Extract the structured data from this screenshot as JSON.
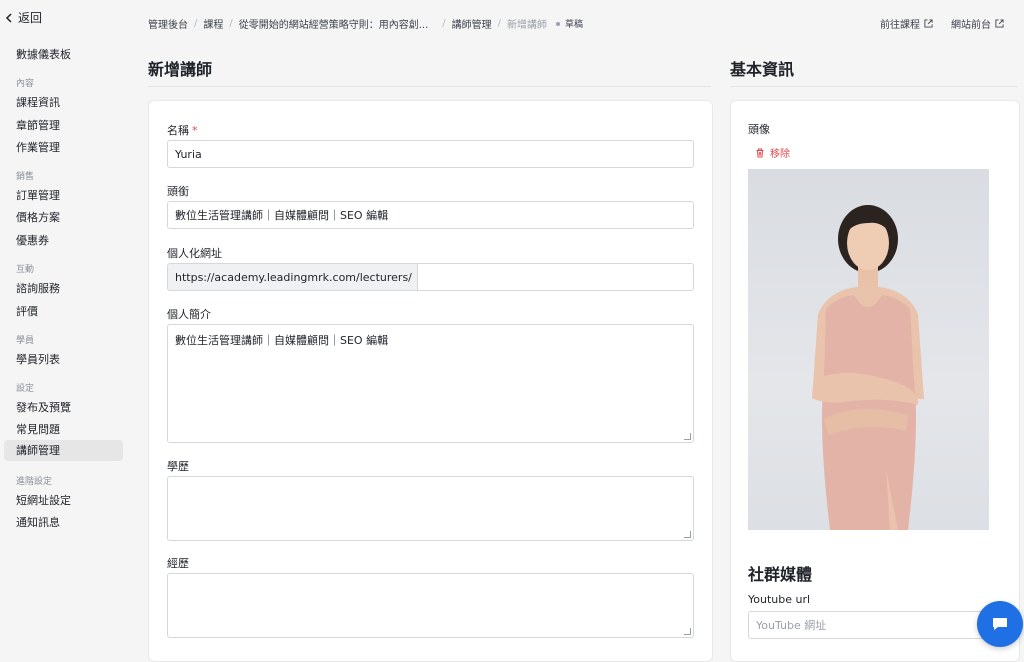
{
  "sidebar": {
    "back_label": "返回",
    "dashboard": "數據儀表板",
    "groups": {
      "content": "內容",
      "sales": "銷售",
      "interaction": "互動",
      "students": "學員",
      "settings": "設定",
      "advanced": "進階設定"
    },
    "items": {
      "course_info": "課程資訊",
      "chapters": "章節管理",
      "homework": "作業管理",
      "orders": "訂單管理",
      "pricing": "價格方案",
      "coupons": "優惠券",
      "consulting": "諮詢服務",
      "reviews": "評價",
      "student_list": "學員列表",
      "publish": "發布及預覽",
      "faq": "常見問題",
      "lecturers": "講師管理",
      "short_url": "短網址設定",
      "notifications": "通知訊息"
    }
  },
  "breadcrumb": {
    "admin": "管理後台",
    "course": "課程",
    "course_title": "從零開始的網站經營策略守則：用內容創...",
    "lecturers": "講師管理",
    "current": "新增講師",
    "status": "草稿"
  },
  "top_links": {
    "go_course": "前往課程",
    "front_site": "網站前台"
  },
  "left_heading": "新增講師",
  "right_heading": "基本資訊",
  "form": {
    "name_label": "名稱",
    "name_required": "*",
    "name_value": "Yuria",
    "title_label": "頭銜",
    "title_value": "數位生活管理講師｜自媒體顧問｜SEO 編輯",
    "url_label": "個人化網址",
    "url_prefix": "https://academy.leadingmrk.com/lecturers/",
    "bio_label": "個人簡介",
    "bio_value": "數位生活管理講師｜自媒體顧問｜SEO 編輯",
    "education_label": "學歷",
    "experience_label": "經歷"
  },
  "basic": {
    "avatar_label": "頭像",
    "remove_label": "移除",
    "social_title": "社群媒體",
    "youtube_label": "Youtube url",
    "youtube_placeholder": "YouTube 網址"
  },
  "colors": {
    "accent": "#1f6fe5",
    "danger": "#e5484d",
    "dress": "#e3b3a8"
  }
}
